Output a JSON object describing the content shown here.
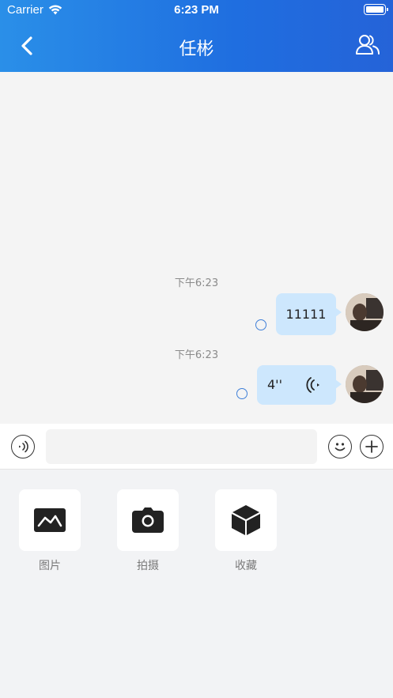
{
  "status_bar": {
    "carrier": "Carrier",
    "time": "6:23 PM"
  },
  "header": {
    "title": "任彬",
    "back_icon": "chevron-left-icon",
    "contacts_icon": "people-icon"
  },
  "messages": [
    {
      "timestamp": "下午6:23",
      "type": "text",
      "content": "11111"
    },
    {
      "timestamp": "下午6:23",
      "type": "voice",
      "duration": "4''"
    }
  ],
  "input_bar": {
    "placeholder": "",
    "left_icon": "voice-toggle-icon",
    "emoji_icon": "emoji-icon",
    "plus_icon": "plus-icon"
  },
  "tools": [
    {
      "label": "图片",
      "icon": "image-icon"
    },
    {
      "label": "拍摄",
      "icon": "camera-icon"
    },
    {
      "label": "收藏",
      "icon": "box-icon"
    }
  ],
  "colors": {
    "header_start": "#2a8fe8",
    "header_end": "#2563d8",
    "bubble": "#cde7fd",
    "status_ring": "#3f7fd8"
  }
}
